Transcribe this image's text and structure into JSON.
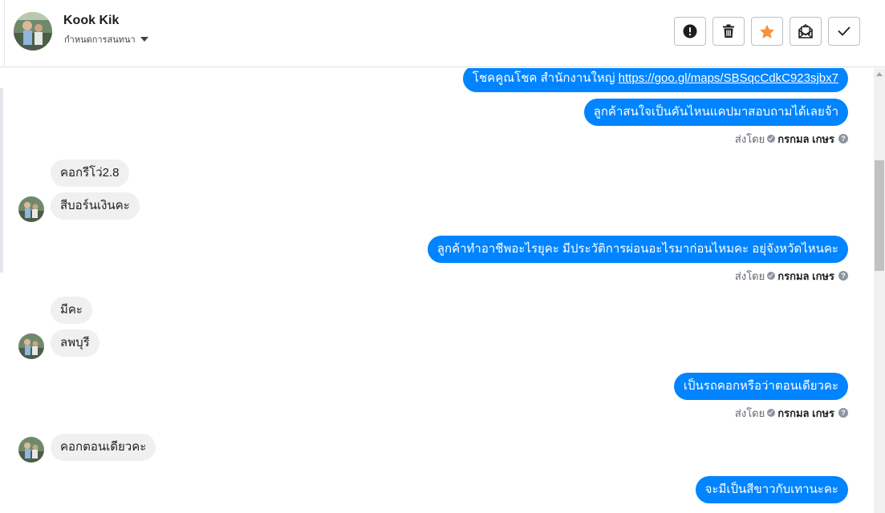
{
  "header": {
    "contact_name": "Kook Kik",
    "conversation_settings_label": "กำหนดการสนทนา",
    "actions": [
      {
        "name": "report-button",
        "icon": "exclamation-circle-icon"
      },
      {
        "name": "delete-button",
        "icon": "trash-icon"
      },
      {
        "name": "star-button",
        "icon": "star-icon",
        "color": "#f7923a"
      },
      {
        "name": "mark-unread-button",
        "icon": "envelope-icon"
      },
      {
        "name": "mark-done-button",
        "icon": "check-icon"
      }
    ]
  },
  "sent_by_label": "ส่งโดย",
  "messages": [
    {
      "direction": "outgoing",
      "text": "โชคคูณโชค สำนักงานใหญ่ ",
      "link": "https://goo.gl/maps/SBSqcCdkC923sjbx7"
    },
    {
      "direction": "outgoing",
      "text": "ลูกค้าสนใจเป็นคันไหนแคปมาสอบถามได้เลยจ้า"
    },
    {
      "direction": "meta",
      "sender": "กรกมล เกษร"
    },
    {
      "direction": "incoming",
      "text": "คอกรีโว่2.8"
    },
    {
      "direction": "incoming",
      "text": "สีบอร์นเงินคะ"
    },
    {
      "direction": "outgoing",
      "text": "ลูกค้าทำอาชีพอะไรยุคะ   มีประวัติการผ่อนอะไรมาก่อนไหมคะ อยุ่จังหวัดไหนคะ"
    },
    {
      "direction": "meta",
      "sender": "กรกมล เกษร"
    },
    {
      "direction": "incoming",
      "text": "มีคะ"
    },
    {
      "direction": "incoming",
      "text": "ลพบุรี"
    },
    {
      "direction": "outgoing",
      "text": "เป็นรถคอกหรือว่าตอนเดียวคะ"
    },
    {
      "direction": "meta",
      "sender": "กรกมล เกษร"
    },
    {
      "direction": "incoming",
      "text": "คอกตอนเดียวคะ"
    },
    {
      "direction": "outgoing",
      "text": "จะมีเป็นสีขาวกับเทานะคะ"
    }
  ],
  "colors": {
    "outgoing_bubble": "#0084ff",
    "incoming_bubble": "#f0f0f0",
    "star": "#f7923a"
  }
}
